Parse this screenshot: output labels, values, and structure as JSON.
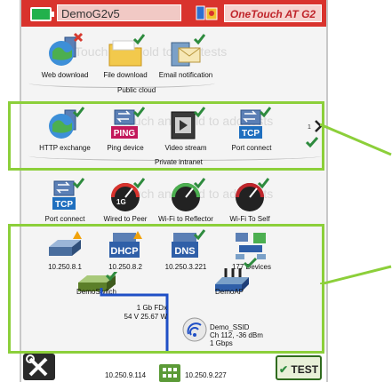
{
  "status_bar": {
    "device_name": "DemoG2v5",
    "product_name": "OneTouch AT G2",
    "battery_icon": "battery-icon",
    "alert_icon": "alert-icon"
  },
  "ghost_hint": "Touch and hold to add tests",
  "public_cloud": {
    "group_label": "Public cloud",
    "tiles": [
      {
        "label": "Web download",
        "icon": "globe-server-icon",
        "status": "fail"
      },
      {
        "label": "File download",
        "icon": "folder-icon",
        "status": "pass"
      },
      {
        "label": "Email notification",
        "icon": "email-icon",
        "status": "pass"
      }
    ]
  },
  "private_intranet": {
    "group_label": "Private intranet",
    "tiles": [
      {
        "label": "HTTP exchange",
        "icon": "globe-server-icon",
        "status": "pass"
      },
      {
        "label": "Ping device",
        "icon": "ping-icon",
        "status": "pass",
        "badge": "PING"
      },
      {
        "label": "Video stream",
        "icon": "video-icon",
        "status": "pass"
      },
      {
        "label": "Port connect",
        "icon": "tcp-icon",
        "status": "pass",
        "badge": "TCP"
      }
    ],
    "page": "1"
  },
  "performance": {
    "tiles": [
      {
        "label": "Port connect",
        "icon": "tcp-icon",
        "status": "pass",
        "badge": "TCP"
      },
      {
        "label": "Wired to Peer",
        "icon": "gauge-icon",
        "status": "pass",
        "badge": "1G"
      },
      {
        "label": "Wi-Fi to Reflector",
        "icon": "gauge-icon",
        "status": "pass"
      },
      {
        "label": "Wi-Fi To Self",
        "icon": "gauge-icon",
        "status": "pass"
      }
    ]
  },
  "network": {
    "devices": [
      {
        "label": "10.250.8.1",
        "icon": "router-icon",
        "status": "warn"
      },
      {
        "label": "10.250.8.2",
        "icon": "dhcp-icon",
        "status": "warn",
        "badge": "DHCP"
      },
      {
        "label": "10.250.3.221",
        "icon": "dns-icon",
        "status": "pass",
        "badge": "DNS"
      },
      {
        "label": "177 Devices",
        "icon": "devices-icon",
        "status": ""
      }
    ],
    "switch_label": "DemoSwitch",
    "ap_label": "DemoAP",
    "link_speed": "1 Gb FDx",
    "poe": "54 V 25.67 W",
    "ssid": "Demo_SSID",
    "channel": "Ch 112, -36 dBm",
    "wifi_rate": "1 Gbps",
    "wired_ip": "10.250.9.114",
    "wifi_ip": "10.250.9.227"
  },
  "bottom": {
    "test_label": "TEST",
    "tools_icon": "tools-icon",
    "test_check_icon": "check-icon"
  },
  "colors": {
    "topbar": "#d9332d",
    "callout": "#8ccf3a",
    "pass": "#2e8b3e",
    "warn": "#f0a20b",
    "fail": "#d63a2f",
    "link": "#1f4fc6"
  }
}
